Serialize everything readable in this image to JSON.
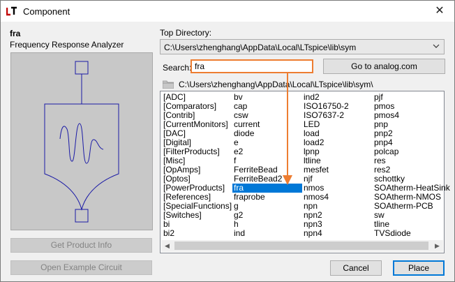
{
  "window": {
    "title": "Component",
    "close_glyph": "✕"
  },
  "component": {
    "name": "fra",
    "description": "Frequency Response Analyzer"
  },
  "left_buttons": {
    "product_info": "Get Product Info",
    "example_circuit": "Open Example Circuit"
  },
  "top_directory": {
    "label": "Top Directory:",
    "value": "C:\\Users\\zhenghang\\AppData\\Local\\LTspice\\lib\\sym"
  },
  "search": {
    "label": "Search:",
    "value": "fra",
    "go_button": "Go to analog.com"
  },
  "current_path": "C:\\Users\\zhenghang\\AppData\\Local\\LTspice\\lib\\sym\\",
  "list": {
    "selected": "fra",
    "columns": [
      [
        "[ADC]",
        "[Comparators]",
        "[Contrib]",
        "[CurrentMonitors]",
        "[DAC]",
        "[Digital]",
        "[FilterProducts]",
        "[Misc]",
        "[OpAmps]",
        "[Optos]",
        "[PowerProducts]",
        "[References]",
        "[SpecialFunctions]",
        "[Switches]",
        "bi",
        "bi2"
      ],
      [
        "bv",
        "cap",
        "csw",
        "current",
        "diode",
        "e",
        "e2",
        "f",
        "FerriteBead",
        "FerriteBead2",
        "fra",
        "fraprobe",
        "g",
        "g2",
        "h",
        "ind"
      ],
      [
        "ind2",
        "ISO16750-2",
        "ISO7637-2",
        "LED",
        "load",
        "load2",
        "lpnp",
        "ltline",
        "mesfet",
        "njf",
        "nmos",
        "nmos4",
        "npn",
        "npn2",
        "npn3",
        "npn4"
      ],
      [
        "pjf",
        "pmos",
        "pmos4",
        "pnp",
        "pnp2",
        "pnp4",
        "polcap",
        "res",
        "res2",
        "schottky",
        "SOAtherm-HeatSink",
        "SOAtherm-NMOS",
        "SOAtherm-PCB",
        "sw",
        "tline",
        "TVSdiode"
      ]
    ]
  },
  "dialog_buttons": {
    "cancel": "Cancel",
    "place": "Place"
  },
  "colors": {
    "accent": "#0078d7",
    "highlight": "#ed7d31",
    "symbol": "#1a1aa6"
  },
  "icons": [
    "ltspice-app-icon",
    "close-icon",
    "chevron-down-icon",
    "folder-icon",
    "scroll-left-icon",
    "scroll-right-icon"
  ]
}
